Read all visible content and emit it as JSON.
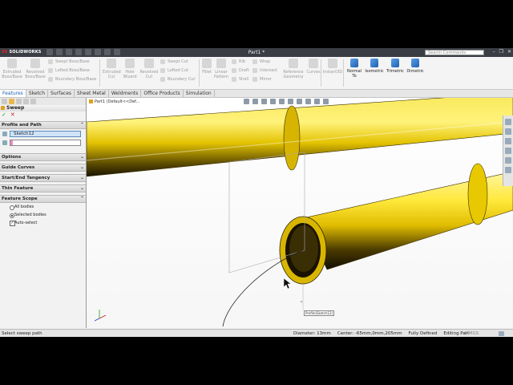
{
  "app": {
    "brand": "SOLIDWORKS",
    "doc_title": "Part1 *",
    "search_placeholder": "Search Commands"
  },
  "window_controls": [
    "–",
    "❐",
    "✕"
  ],
  "features_toolbar": {
    "large": [
      {
        "label1": "Extruded",
        "label2": "Boss/Base"
      },
      {
        "label1": "Revolved",
        "label2": "Boss/Base"
      },
      {
        "label1": "Extruded",
        "label2": "Cut"
      },
      {
        "label1": "Hole",
        "label2": "Wizard"
      },
      {
        "label1": "Revolved",
        "label2": "Cut"
      },
      {
        "label1": "Fillet",
        "label2": ""
      },
      {
        "label1": "Linear",
        "label2": "Pattern"
      },
      {
        "label1": "Reference",
        "label2": "Geometry"
      },
      {
        "label1": "Curves",
        "label2": ""
      },
      {
        "label1": "Instant3D",
        "label2": ""
      }
    ],
    "small": [
      "Swept Boss/Base",
      "Lofted Boss/Base",
      "Boundary Boss/Base",
      "Swept Cut",
      "Lofted Cut",
      "Boundary Cut",
      "Rib",
      "Draft",
      "Shell",
      "Wrap",
      "Intersect",
      "Mirror"
    ],
    "views": [
      {
        "label1": "Normal",
        "label2": "To"
      },
      {
        "label1": "Isometric",
        "label2": ""
      },
      {
        "label1": "Trimetric",
        "label2": ""
      },
      {
        "label1": "Dimetric",
        "label2": ""
      }
    ]
  },
  "tabs": [
    "Features",
    "Sketch",
    "Surfaces",
    "Sheet Metal",
    "Weldments",
    "Office Products",
    "Simulation"
  ],
  "property_manager": {
    "title": "Sweep",
    "ok": "✓",
    "cancel": "✕",
    "profile_path": {
      "label": "Profile and Path",
      "profile": "Sketch12",
      "path": ""
    },
    "sections": [
      "Options",
      "Guide Curves",
      "Start/End Tangency",
      "Thin Feature"
    ],
    "feature_scope": {
      "label": "Feature Scope",
      "all_bodies": "All bodies",
      "selected_bodies": "Selected bodies",
      "auto_select": "Auto-select"
    }
  },
  "viewport": {
    "tree": "Part1 (Default<<Def...",
    "callout": "Profile(Sketch12)",
    "colors": {
      "pipe_light": "#fff27a",
      "pipe_mid": "#e3c200",
      "pipe_dark": "#2a2000"
    }
  },
  "status": {
    "left": "Select sweep path",
    "diameter": "Diameter: 13mm",
    "center": "Center: -65mm,0mm,205mm",
    "defined": "Fully Defined",
    "mode": "Editing Part",
    "units": "MMGS"
  }
}
